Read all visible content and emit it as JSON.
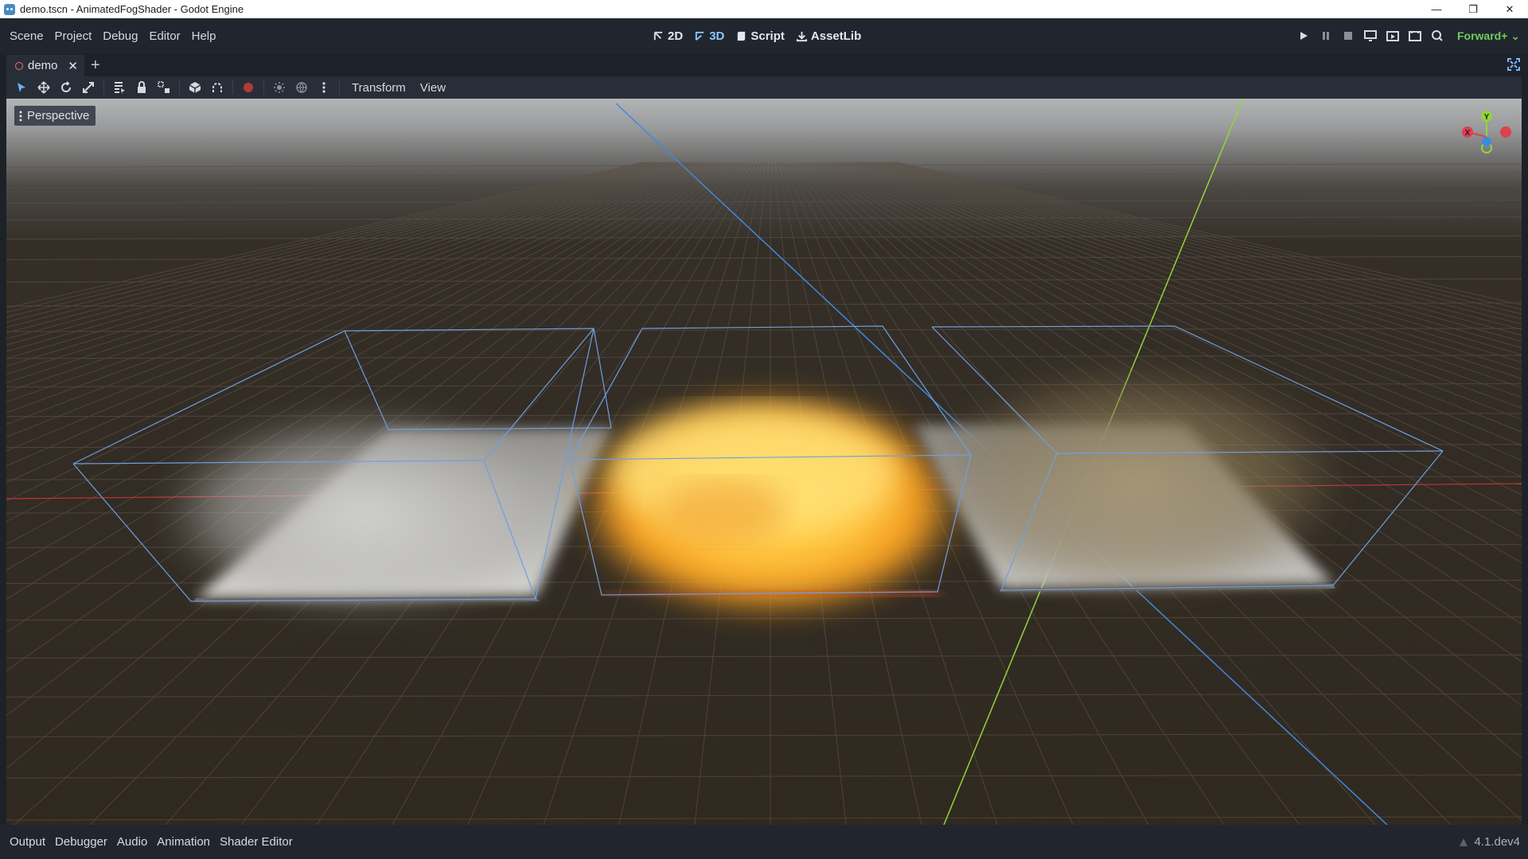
{
  "window": {
    "title": "demo.tscn - AnimatedFogShader - Godot Engine",
    "controls": [
      "minimize-icon",
      "restore-icon",
      "close-icon"
    ]
  },
  "menubar": {
    "menus": [
      "Scene",
      "Project",
      "Debug",
      "Editor",
      "Help"
    ],
    "workspaces": [
      {
        "label": "2D",
        "icon": "2d-icon"
      },
      {
        "label": "3D",
        "icon": "3d-icon",
        "active": true
      },
      {
        "label": "Script",
        "icon": "script-icon"
      },
      {
        "label": "AssetLib",
        "icon": "assetlib-icon"
      }
    ],
    "renderer": "Forward+"
  },
  "scene_tabs": {
    "tabs": [
      {
        "label": "demo"
      }
    ]
  },
  "toolbar": {
    "transform_menu": "Transform",
    "view_menu": "View"
  },
  "viewport": {
    "perspective_label": "Perspective",
    "gizmo": {
      "y": "Y",
      "x": "X"
    }
  },
  "bottom_panel": {
    "tabs": [
      "Output",
      "Debugger",
      "Audio",
      "Animation",
      "Shader Editor"
    ],
    "version": "4.1.dev4"
  },
  "colors": {
    "accent": "#6db3ff",
    "renderer": "#6fcf5c",
    "axis_x": "#e0404e",
    "axis_y": "#93d43a",
    "axis_z": "#3d8bdd"
  }
}
